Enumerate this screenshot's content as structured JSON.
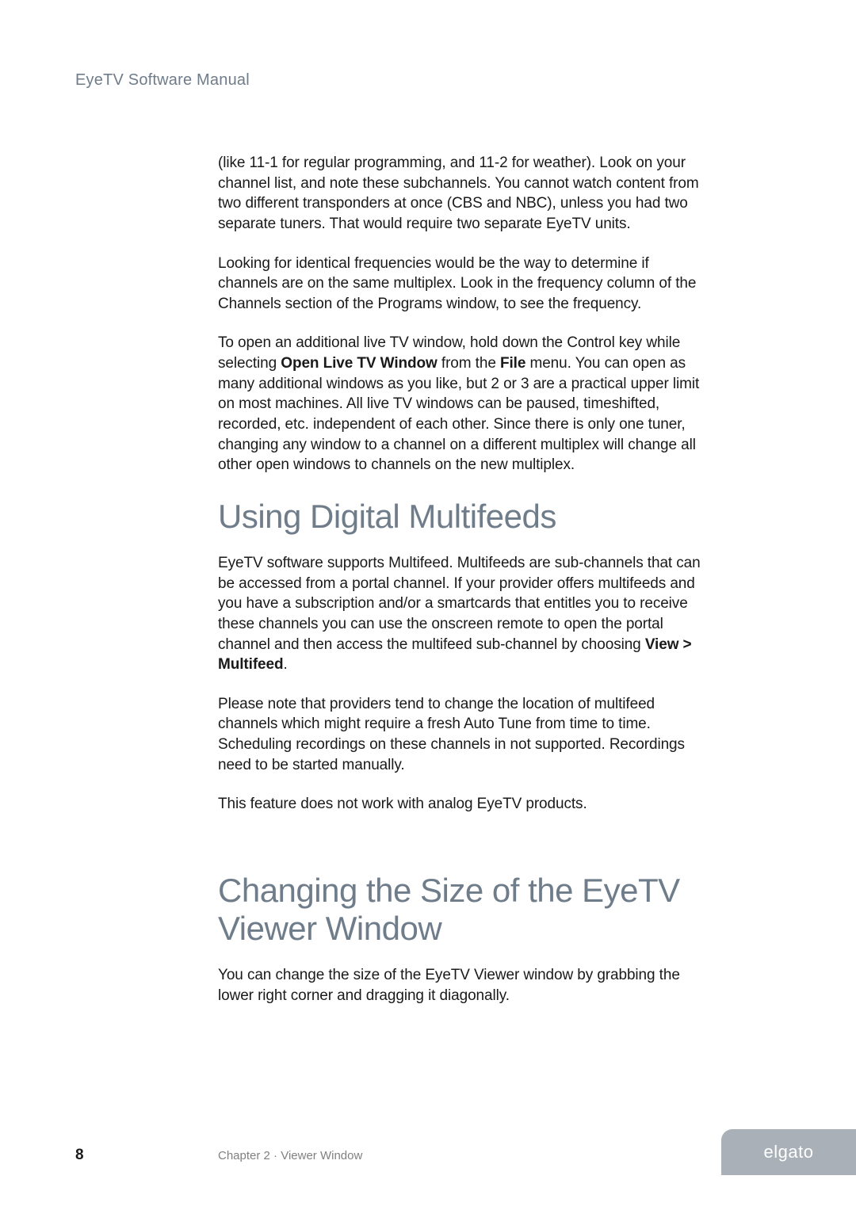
{
  "header": {
    "running_title": "EyeTV Software Manual"
  },
  "paragraphs": {
    "p1": "(like 11-1 for regular programming, and 11-2 for weather).  Look on your channel list, and note these subchannels.  You cannot watch content from two different transponders at once (CBS and NBC), unless you had two separate tuners.  That would require two separate EyeTV units.",
    "p2": "Looking for identical frequencies would be the way to determine if channels are on the same multiplex.  Look in the frequency column of the Channels section of the Programs window, to see the frequency.",
    "p3_a": "To open an additional live TV window, hold down the Control key while selecting ",
    "p3_bold1": "Open Live TV Window",
    "p3_b": " from the ",
    "p3_bold2": "File",
    "p3_c": " menu. You can open as many additional windows as you like, but 2 or 3 are a practical upper limit on most machines. All live TV windows can be paused, timeshifted, recorded, etc. independent of each other. Since there is only one tuner, changing any window to a channel on a different multiplex will change all other open windows to channels on the new multiplex."
  },
  "section1": {
    "heading": "Using Digital Multifeeds",
    "p1_a": "EyeTV software supports Multifeed. Multifeeds are sub-channels that can be accessed from a portal channel. If your provider offers multifeeds and you have a subscription and/or a smartcards that entitles you to receive these channels you can use the onscreen remote to open the portal channel and then access the multifeed sub-channel by choosing ",
    "p1_bold": "View > Multifeed",
    "p1_b": ".",
    "p2": "Please note that providers tend to change the location of multifeed channels which might require a fresh Auto Tune from time to time. Scheduling recordings on these channels in not supported. Recordings need to be started manually.",
    "p3": "This feature does not work with analog EyeTV products."
  },
  "section2": {
    "heading": "Changing the Size of the EyeTV Viewer Window",
    "p1": "You can change the size of the EyeTV Viewer window by grabbing the lower right corner and dragging it diagonally."
  },
  "footer": {
    "page_number": "8",
    "chapter": "Chapter 2 · Viewer Window",
    "brand": "elgato"
  }
}
